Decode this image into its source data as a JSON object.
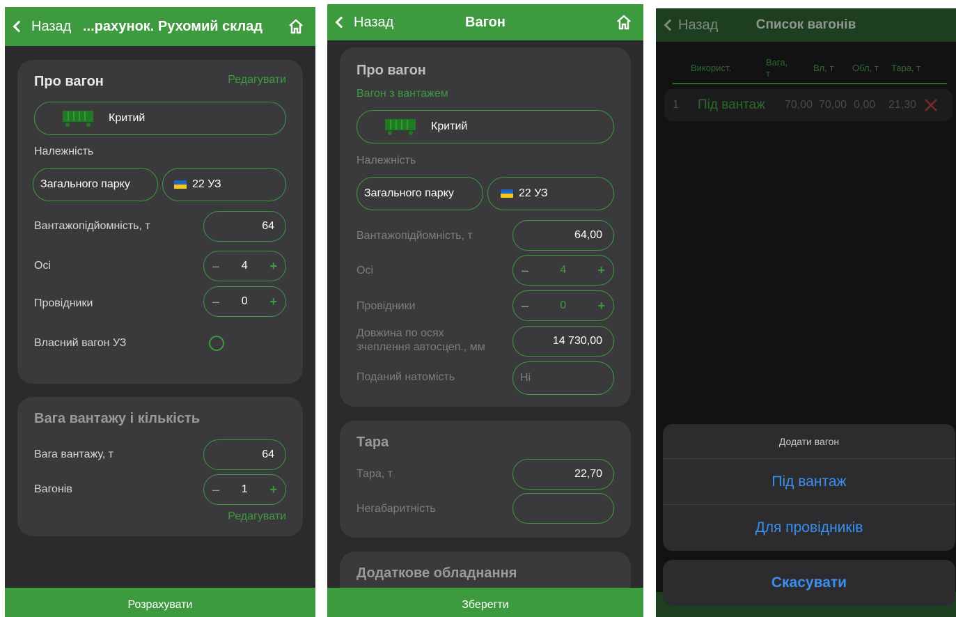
{
  "colors": {
    "accent": "#3d9a3f",
    "bg": "#2b2b2d",
    "card": "#3a3a3c",
    "ios_blue": "#3b8ff0",
    "danger": "#e0433a"
  },
  "screen1": {
    "header": {
      "back_label": "Назад",
      "title": "...рахунок. Рухомий склад"
    },
    "about": {
      "title": "Про вагон",
      "edit_link": "Редагувати",
      "wagon_type": "Критий",
      "ownership_label": "Належність",
      "park": "Загального парку",
      "railway": "22 УЗ",
      "capacity_label": "Вантажопідйомність, т",
      "capacity_value": "64",
      "axles_label": "Осі",
      "axles_value": "4",
      "conductors_label": "Провідники",
      "conductors_value": "0",
      "own_wagon_label": "Власний вагон УЗ"
    },
    "cargo": {
      "title": "Вага вантажу і кількість",
      "weight_label": "Вага вантажу, т",
      "weight_value": "64",
      "wagons_label": "Вагонів",
      "wagons_value": "1",
      "edit_link": "Редагувати"
    },
    "stepper_minus": "–",
    "stepper_plus": "+",
    "bottom_button": "Розрахувати"
  },
  "screen2": {
    "header": {
      "back_label": "Назад",
      "title": "Вагон"
    },
    "about": {
      "title": "Про вагон",
      "subtitle_link": "Вагон з вантажем",
      "wagon_type": "Критий",
      "ownership_label": "Належність",
      "park": "Загального парку",
      "railway": "22 УЗ",
      "capacity_label": "Вантажопідйомність, т",
      "capacity_value": "64,00",
      "axles_label": "Осі",
      "axles_value": "4",
      "conductors_label": "Провідники",
      "conductors_value": "0",
      "length_label_line1": "Довжина по осях",
      "length_label_line2": "зчеплення автосцеп., мм",
      "length_value": "14 730,00",
      "instead_label": "Поданий натомість",
      "instead_placeholder": "Ні"
    },
    "tare": {
      "title": "Тара",
      "tare_label": "Тара, т",
      "tare_value": "22,70",
      "oversize_label": "Негабаритність",
      "oversize_value": ""
    },
    "equipment": {
      "title": "Додаткове обладнання"
    },
    "stepper_minus": "–",
    "stepper_plus": "+",
    "bottom_button": "Зберегти"
  },
  "screen3": {
    "header": {
      "back_label": "Назад",
      "title": "Список вагонів"
    },
    "columns": [
      "Використ.",
      "Вага, т",
      "Вл, т",
      "Обл, т",
      "Тара, т"
    ],
    "row": {
      "num": "1",
      "use": "Під вантаж",
      "weight": "70,00",
      "own": "70,00",
      "equip": "0,00",
      "tare": "21,30"
    },
    "sheet": {
      "title": "Додати вагон",
      "option1": "Під вантаж",
      "option2": "Для провідників",
      "cancel": "Скасувати"
    }
  }
}
